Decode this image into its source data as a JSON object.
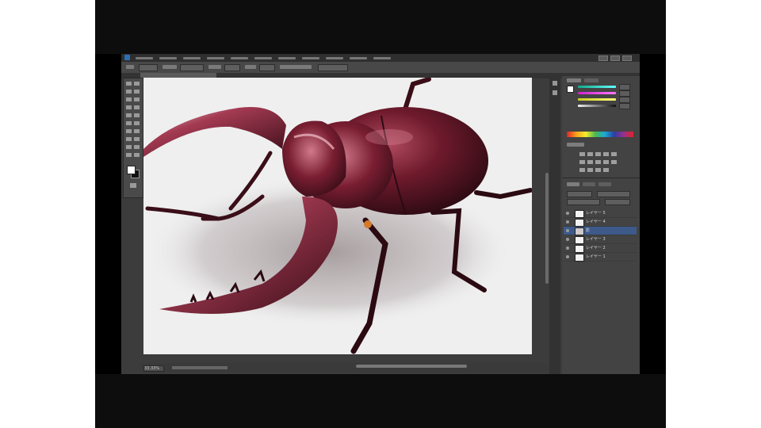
{
  "app": {
    "name": "Adobe Photoshop",
    "brand_color": "#2c6fb3"
  },
  "status_bar": {
    "zoom": "33.33%"
  },
  "layers": [
    {
      "name": "レイヤー 5",
      "visible": true,
      "active": false
    },
    {
      "name": "レイヤー 4",
      "visible": true,
      "active": false
    },
    {
      "name": "影",
      "visible": true,
      "active": true
    },
    {
      "name": "レイヤー 3",
      "visible": true,
      "active": false
    },
    {
      "name": "レイヤー 2",
      "visible": true,
      "active": false
    },
    {
      "name": "レイヤー 1",
      "visible": true,
      "active": false
    }
  ],
  "canvas": {
    "subject": "stag-beetle-illustration",
    "colors": {
      "body_dark": "#3a0e18",
      "body_mid": "#7a1e32",
      "highlight": "#d07a8c",
      "background": "#efefef",
      "shadow": "#b9b0b2"
    }
  },
  "icons": {
    "swatches": "color-swatch-icon",
    "visibility": "eye-icon",
    "logo": "ps-logo-icon"
  }
}
